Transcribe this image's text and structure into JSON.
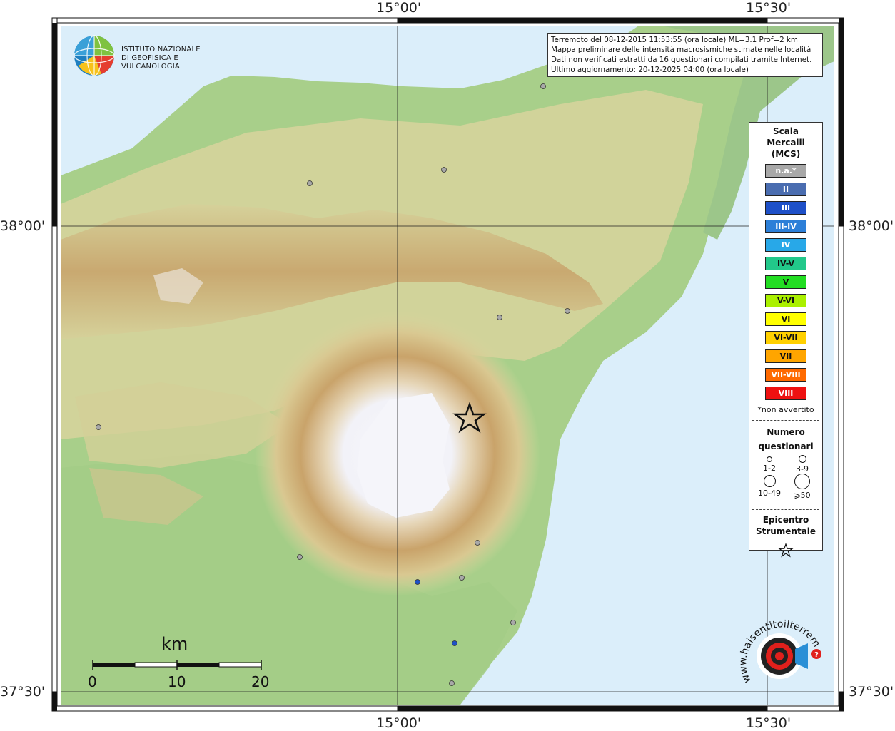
{
  "axes": {
    "top_left": "15°00'",
    "top_right": "15°30'",
    "bottom_left": "15°00'",
    "bottom_right": "15°30'",
    "left_top": "38°00'",
    "left_bottom": "37°30'",
    "right_top": "38°00'",
    "right_bottom": "37°30'"
  },
  "logo": {
    "line1": "ISTITUTO NAZIONALE",
    "line2": "DI GEOFISICA E VULCANOLOGIA",
    "icon": "globe-logo-icon"
  },
  "info": {
    "line1": "Terremoto del 08-12-2015 11:53:55 (ora locale) ML=3.1 Prof=2 km",
    "line2": "Mappa preliminare delle intensità macrosismiche stimate nelle località",
    "line3": "Dati non verificati estratti da 16 questionari compilati tramite Internet.",
    "line4": "Ultimo aggiornamento: 20-12-2025 04:00 (ora locale)"
  },
  "legend": {
    "title": "Scala Mercalli (MCS)",
    "items": [
      {
        "label": "n.a.*",
        "color": "#a8a8a8",
        "text_color": "#ffffff"
      },
      {
        "label": "II",
        "color": "#4a6db0",
        "text_color": "#ffffff"
      },
      {
        "label": "III",
        "color": "#1e50c8",
        "text_color": "#ffffff"
      },
      {
        "label": "III-IV",
        "color": "#2c7fd8",
        "text_color": "#ffffff"
      },
      {
        "label": "IV",
        "color": "#28a8e8",
        "text_color": "#ffffff"
      },
      {
        "label": "IV-V",
        "color": "#22c88a",
        "text_color": "#111111"
      },
      {
        "label": "V",
        "color": "#22dd22",
        "text_color": "#111111"
      },
      {
        "label": "V-VI",
        "color": "#aaf000",
        "text_color": "#111111"
      },
      {
        "label": "VI",
        "color": "#ffff00",
        "text_color": "#111111"
      },
      {
        "label": "VI-VII",
        "color": "#ffd000",
        "text_color": "#111111"
      },
      {
        "label": "VII",
        "color": "#ffa500",
        "text_color": "#111111"
      },
      {
        "label": "VII-VIII",
        "color": "#ff6a00",
        "text_color": "#ffffff"
      },
      {
        "label": "VIII",
        "color": "#ee1111",
        "text_color": "#ffffff"
      }
    ],
    "note": "*non avvertito",
    "questionnaires_title": "Numero questionari",
    "questionnaires": [
      "1-2",
      "3-9",
      "10-49",
      "⩾50"
    ],
    "epicenter_title": "Epicentro Strumentale",
    "epicenter_icon": "star-icon"
  },
  "scale_bar": {
    "unit": "km",
    "ticks": [
      "0",
      "10",
      "20"
    ]
  },
  "badge": {
    "text": "www.haisentitoilterremoto.it",
    "icon": "haisentitoilterremoto-logo-icon",
    "color": "#e0201c"
  },
  "stations": [
    {
      "name": "na-station",
      "intensity": "n.a."
    },
    {
      "name": "na-station",
      "intensity": "n.a."
    },
    {
      "name": "na-station",
      "intensity": "n.a."
    },
    {
      "name": "na-station",
      "intensity": "n.a."
    },
    {
      "name": "na-station",
      "intensity": "n.a."
    },
    {
      "name": "na-station",
      "intensity": "n.a."
    },
    {
      "name": "na-station",
      "intensity": "n.a."
    },
    {
      "name": "na-station",
      "intensity": "n.a."
    },
    {
      "name": "na-station",
      "intensity": "n.a."
    },
    {
      "name": "na-station",
      "intensity": "n.a."
    },
    {
      "name": "na-station",
      "intensity": "n.a."
    },
    {
      "name": "intensity-II-station",
      "intensity": "III"
    },
    {
      "name": "intensity-II-station",
      "intensity": "III"
    }
  ],
  "epicenter": {
    "icon": "epicenter-star-icon"
  },
  "colors": {
    "sea": "#dbeefa",
    "lowland": "#a8cf8a",
    "hill": "#d8d49c",
    "mountain": "#c9a66b",
    "summit": "#f4f4fa"
  }
}
